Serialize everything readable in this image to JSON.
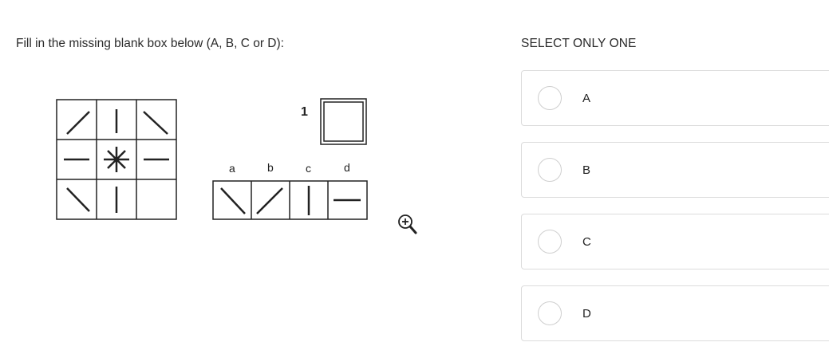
{
  "question": {
    "text": "Fill in the missing blank box below (A, B, C or D):"
  },
  "figure": {
    "missing_index_label": "1",
    "answer_letters": [
      "a",
      "b",
      "c",
      "d"
    ]
  },
  "zoom": {
    "icon": "zoom-in-icon"
  },
  "answers": {
    "title": "SELECT ONLY ONE",
    "options": [
      {
        "label": "A"
      },
      {
        "label": "B"
      },
      {
        "label": "C"
      },
      {
        "label": "D"
      }
    ]
  }
}
